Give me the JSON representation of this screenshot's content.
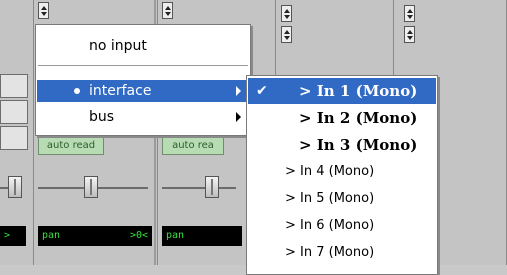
{
  "menu": {
    "items": [
      {
        "label": "no input"
      },
      {
        "label": "interface"
      },
      {
        "label": "bus"
      }
    ]
  },
  "submenu": {
    "items": [
      {
        "label": "> In 1 (Mono)"
      },
      {
        "label": "> In 2 (Mono)"
      },
      {
        "label": "> In 3 (Mono)"
      },
      {
        "label": "> In 4 (Mono)"
      },
      {
        "label": "> In 5 (Mono)"
      },
      {
        "label": "> In 6 (Mono)"
      },
      {
        "label": "> In 7 (Mono)"
      }
    ],
    "check": "✔"
  },
  "strips": [
    {
      "auto": "auto read",
      "pan": "pan",
      "pan_value": ">0<"
    },
    {
      "auto": "auto rea",
      "pan": "pan",
      "pan_value": ""
    }
  ],
  "left_pan": ">"
}
